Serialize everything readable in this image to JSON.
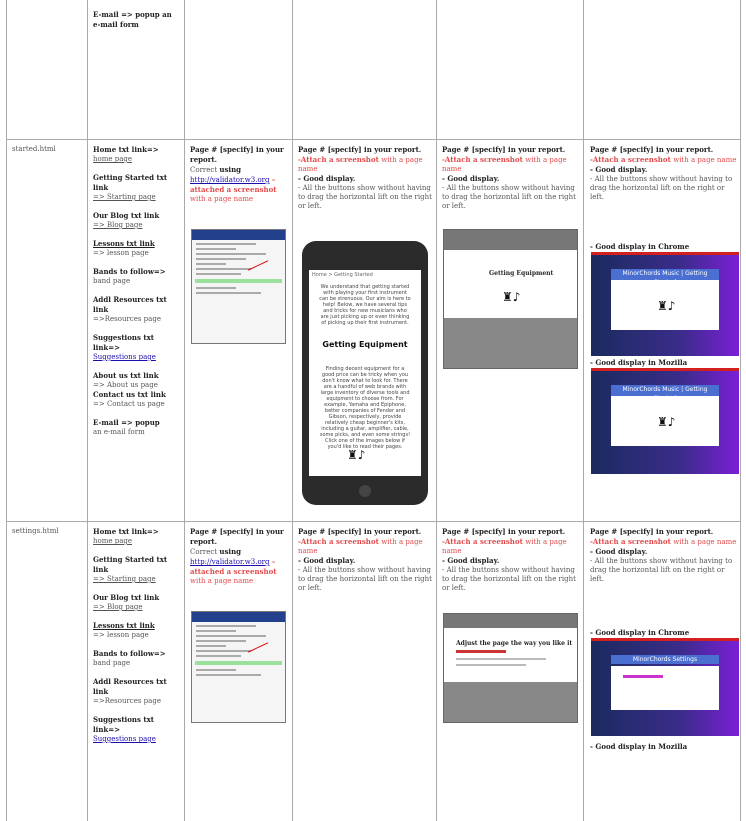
{
  "rows": {
    "r0": {
      "nav": [
        "E-mail => popup an e-mail form"
      ]
    },
    "r1": {
      "file": "started.html",
      "nav": {
        "home_b": "Home txt link=>",
        "home_v": "home page",
        "gs_b": "Getting Started txt link",
        "gs_v": "=> Starting page",
        "blog_b": "Our Blog txt link",
        "blog_v": "=> Blog page",
        "lessons_b": "Lessons txt link",
        "lessons_v": "=> lesson page",
        "bands_b": "Bands to follow=>",
        "bands_v": "band page",
        "addl_b": "Addl Resources txt link",
        "addl_v": "=>Resources page",
        "sugg_b": "Suggestions txt link=>",
        "sugg_v": "Suggestions page",
        "about_b": "About us txt link",
        "about_v": "=> About us page",
        "contact_b": "Contact us txt link",
        "contact_v": "=> Contact us page",
        "email_b": "E-mail => popup",
        "email_v": "an e-mail form"
      },
      "validate": {
        "b1": "Page # [specify] in your report.",
        "g1": "Correct ",
        "b2": "using",
        "link": "http://validator.w3.org",
        "r1": " – attached a screenshot ",
        "r2": "with a page name"
      },
      "phone": {
        "b1": "Page # [specify] in your report.",
        "r1": "-Attach a screenshot ",
        "r2": "with a page name",
        "good": "- Good display.",
        "g1": "- All the buttons show without having to drag the horizontal lift on the right or left.",
        "crumb": "Home > Getting Started",
        "p1": "We understand that getting started with playing your first instrument can be strenuous. Our aim is here to help! Below, we have several tips and tricks for new musicians who are just picking up or even thinking of picking up their first instrument.",
        "heading": "Getting Equipment",
        "p2": "Finding decent equipment for a good price can be tricky when you don't know what to look for. There are a handful of web brands with large inventory of diverse tools and equipment to choose from. For example, Yamaha and Epiphone, better companies of Fender and Gibson, respectively, provide relatively cheap beginner's kits, including a guitar, amplifier, cable, some picks, and even some strings! Click one of the images below if you'd like to read their pages."
      },
      "gray": {
        "b1": "Page # [specify] in your report.",
        "r1": "-Attach a screenshot ",
        "r2": "with a page name",
        "good": "- Good display.",
        "g1": "- All the buttons show without having to drag the horizontal lift on the right or left.",
        "title": "Getting Equipment"
      },
      "browsers": {
        "b1": "Page # [specify] in your report.",
        "r1": "-Attach a screenshot ",
        "r2": "with a page name",
        "good": "- Good display.",
        "g1": "- All the buttons show without having to drag the horizontal lift on the right or left.",
        "chrome": "- Good display in Chrome",
        "mozilla": "- Good display in Mozilla",
        "site_title": "MinorChords Music | Getting Started"
      }
    },
    "r2": {
      "file": "settings.html",
      "nav": {
        "home_b": "Home txt link=>",
        "home_v": "home page",
        "gs_b": "Getting Started txt link",
        "gs_v": "=> Starting page",
        "blog_b": "Our Blog txt link",
        "blog_v": "=> Blog page",
        "lessons_b": "Lessons txt link",
        "lessons_v": "=> lesson page",
        "bands_b": "Bands to follow=>",
        "bands_v": "band page",
        "addl_b": "Addl Resources txt link",
        "addl_v": "=>Resources page",
        "sugg_b": "Suggestions txt link=>",
        "sugg_v": "Suggestions page"
      },
      "validate": {
        "b1": "Page # [specify] in your report.",
        "g1": "Correct ",
        "b2": "using",
        "link": "http://validator.w3.org",
        "r1": " – attached a screenshot ",
        "r2": "with a page name"
      },
      "text": {
        "b1": "Page # [specify] in your report.",
        "r1": "-Attach a screenshot ",
        "r2": "with a page name",
        "good": "- Good display.",
        "g1": "- All the buttons show without having to drag the horizontal lift on the right or left."
      },
      "gray": {
        "b1": "Page # [specify] in your report.",
        "r1": "-Attach a screenshot ",
        "r2": "with a page name",
        "good": "- Good display.",
        "g1": "- All the buttons show without having to drag the horizontal lift on the right or left.",
        "title": "Adjust the page the way you like it"
      },
      "browsers": {
        "b1": "Page # [specify] in your report.",
        "r1": "-Attach a screenshot ",
        "r2": "with a page name",
        "good": "- Good display.",
        "g1": "- All the buttons show without having to drag the horizontal lift on the right or left.",
        "chrome": "- Good display in Chrome",
        "mozilla": "- Good display in Mozilla",
        "site_title": "MinorChords Settings"
      }
    }
  },
  "icons": {
    "instrument": "guitar-amp-icon"
  },
  "colors": {
    "red": "#e24a4a",
    "link": "#1a0dab",
    "browser_gradient_end": "#7a1fd6"
  }
}
